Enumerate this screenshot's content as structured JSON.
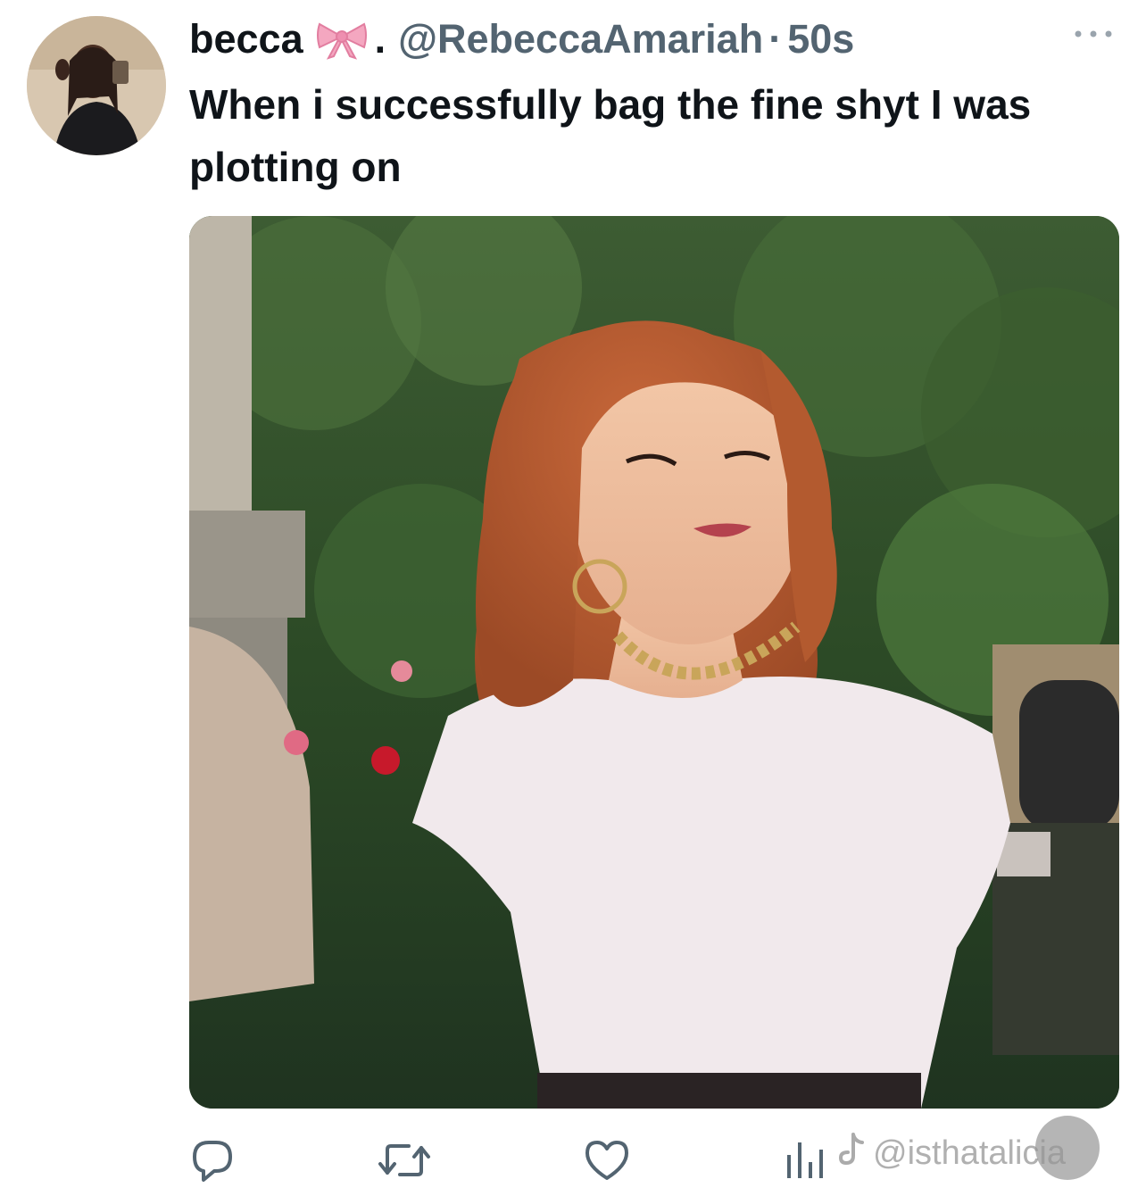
{
  "tweet": {
    "display_name": "becca",
    "name_emoji_icon": "pink-bow-icon",
    "separator": ".",
    "handle": "@RebeccaAmariah",
    "time_separator": "·",
    "timestamp": "50s",
    "more_icon": "more-dots-icon",
    "text": "When i successfully bag the fine shyt I was plotting on",
    "avatar_icon": "profile-avatar",
    "media_icon": "photo-red-haired-woman-smiling"
  },
  "actions": {
    "reply_icon": "reply-icon",
    "retweet_icon": "retweet-icon",
    "like_icon": "heart-icon",
    "views_icon": "bar-chart-icon"
  },
  "watermark": {
    "platform_icon": "tiktok-icon",
    "text": "@isthatalicia"
  },
  "colors": {
    "text": "#0f1419",
    "secondary": "#536471",
    "bow": "#f4a7c0",
    "icon": "#536471"
  }
}
